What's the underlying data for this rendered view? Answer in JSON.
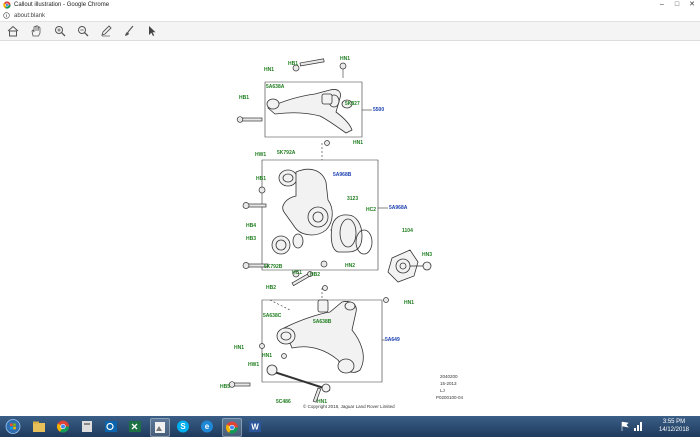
{
  "window": {
    "title": "Callout illustration - Google Chrome",
    "minimize": "–",
    "maximize": "□",
    "close": "✕"
  },
  "address": {
    "url": "about:blank"
  },
  "toolbar": {
    "tools": [
      "home-icon",
      "hand-icon",
      "zoom-in-icon",
      "zoom-out-icon",
      "pen-icon",
      "brush-icon",
      "pointer-icon"
    ]
  },
  "diagram": {
    "callouts": {
      "hb1_top": "HB1",
      "hn1_top": "HN1",
      "hn1_top2": "HN1",
      "fa638a": "5A638A",
      "fk827": "5K827",
      "c5500": "5500",
      "hb1_left": "HB1",
      "hn1_mid": "HN1",
      "hw1_mid": "HW1",
      "fk792a": "5K792A",
      "fa968b": "5A968B",
      "hb1_mid": "HB1",
      "c3123": "3123",
      "hc2": "HC2",
      "fa968a": "5A968A",
      "hb4": "HB4",
      "hb3": "HB3",
      "c1104": "1104",
      "hn3": "HN3",
      "fk792b": "5K792B",
      "hc1": "HC1",
      "hn2": "HN2",
      "hb2a": "HB2",
      "hb2b": "HB2",
      "hn1_low": "HN1",
      "fa638c": "5A638C",
      "fa638b": "5A638B",
      "fa649": "5A649",
      "hn1_low2": "HN1",
      "hn1_low3": "HN1",
      "hw1_low": "HW1",
      "hb5": "HB5",
      "fc486": "5C486",
      "hn1_bot": "HN1"
    },
    "info_lines": [
      "2040200",
      "15-2013",
      "LJ",
      "P0200100-04"
    ],
    "copyright": "© Copyright 2018, Jaguar Land Rover Limited"
  },
  "taskbar": {
    "apps": [
      "start-orb",
      "file-explorer",
      "chrome",
      "outlook",
      "excel",
      "unknown",
      "skype",
      "edge",
      "chrome-active",
      "word"
    ],
    "time": "3:55 PM",
    "date": "14/12/2018"
  },
  "colors": {
    "callout_green": "#1f7d1f",
    "callout_blue": "#1a3fb0",
    "taskbar": "#2a4a70"
  }
}
